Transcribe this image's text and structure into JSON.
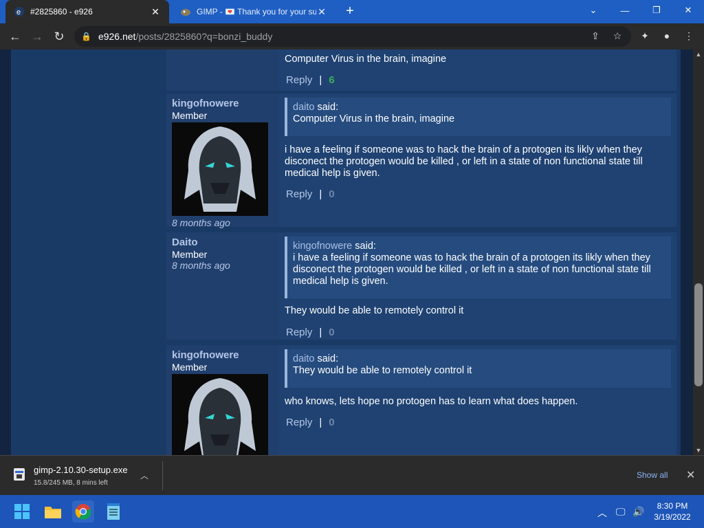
{
  "browser": {
    "tabs": [
      {
        "title": "#2825860 - e926",
        "active": true
      },
      {
        "title": "GIMP - 💌 Thank you for your su",
        "active": false
      }
    ],
    "url_host": "e926.net",
    "url_path": "/posts/2825860?q=bonzi_buddy"
  },
  "posts": [
    {
      "author": "",
      "body": "Computer Virus in the brain, imagine",
      "reply_label": "Reply",
      "separator": "|",
      "score": "6"
    },
    {
      "author": "kingofnowere",
      "role": "Member",
      "ago": "8 months ago",
      "quote_name": "daito",
      "quote_said": "said:",
      "quote_text": "Computer Virus in the brain, imagine",
      "body": "i have a feeling if someone was to hack the brain of a protogen its likly when they disconect the protogen would be killed , or left in a state of non functional state till medical help is given.",
      "reply_label": "Reply",
      "separator": "|",
      "score": "0"
    },
    {
      "author": "Daito",
      "role": "Member",
      "ago": "8 months ago",
      "quote_name": "kingofnowere",
      "quote_said": "said:",
      "quote_text": "i have a feeling if someone was to hack the brain of a protogen its likly when they disconect the protogen would be killed , or left in a state of non functional state till medical help is given.",
      "body": "They would be able to remotely control it",
      "reply_label": "Reply",
      "separator": "|",
      "score": "0"
    },
    {
      "author": "kingofnowere",
      "role": "Member",
      "quote_name": "daito",
      "quote_said": "said:",
      "quote_text": "They would be able to remotely control it",
      "body": "who knows, lets hope no protogen has to learn what does happen.",
      "reply_label": "Reply",
      "separator": "|",
      "score": "0"
    }
  ],
  "download": {
    "filename": "gimp-2.10.30-setup.exe",
    "status": "15.8/245 MB, 8 mins left",
    "show_all": "Show all"
  },
  "taskbar": {
    "time": "8:30 PM",
    "date": "3/19/2022"
  },
  "colors": {
    "accent": "#1f5fc4",
    "page_bg": "#1a3a66",
    "positive_score": "#3fae5a"
  }
}
